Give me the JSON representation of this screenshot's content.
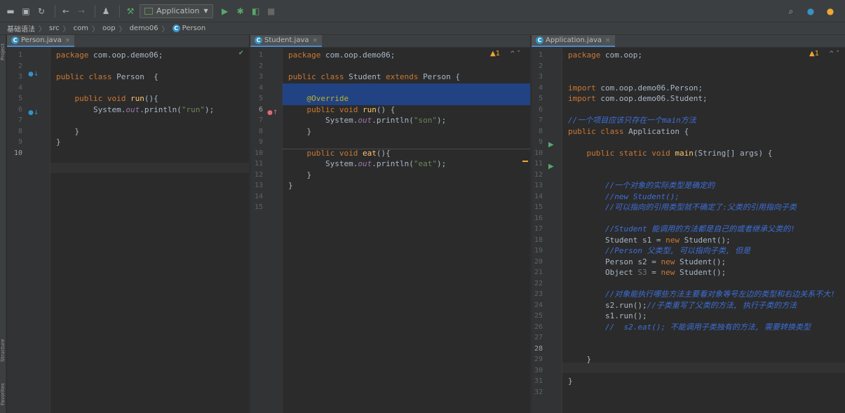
{
  "toolbar": {
    "run_config": "Application"
  },
  "breadcrumb": [
    "基础语法",
    "src",
    "com",
    "oop",
    "demo06",
    "Person"
  ],
  "sidebar": {
    "project": "Project",
    "structure": "Structure",
    "favorites": "Favorites"
  },
  "panes": [
    {
      "tab": "Person.java",
      "line_numbers": [
        "1",
        "2",
        "3",
        "4",
        "5",
        "6",
        "7",
        "8",
        "9",
        "10"
      ],
      "lines": [
        [
          {
            "t": "package ",
            "c": "kw"
          },
          {
            "t": "com.oop.demo06;",
            "c": "pl"
          }
        ],
        [],
        [
          {
            "t": "public class ",
            "c": "kw"
          },
          {
            "t": "Person  {",
            "c": "pl"
          }
        ],
        [],
        [
          {
            "t": "    public void ",
            "c": "kw"
          },
          {
            "t": "run",
            "c": "fn"
          },
          {
            "t": "(){",
            "c": "pl"
          }
        ],
        [
          {
            "t": "        System.",
            "c": "pl"
          },
          {
            "t": "out",
            "c": "it"
          },
          {
            "t": ".println(",
            "c": "pl"
          },
          {
            "t": "\"run\"",
            "c": "str"
          },
          {
            "t": ");",
            "c": "pl"
          }
        ],
        [],
        [
          {
            "t": "    }",
            "c": "pl"
          }
        ],
        [
          {
            "t": "}",
            "c": "pl"
          }
        ],
        []
      ]
    },
    {
      "tab": "Student.java",
      "warning": "▲1",
      "line_numbers": [
        "1",
        "2",
        "3",
        "4",
        "5",
        "6",
        "7",
        "8",
        "9",
        "10",
        "11",
        "12",
        "13",
        "14",
        "15"
      ],
      "lines": [
        [
          {
            "t": "package ",
            "c": "kw"
          },
          {
            "t": "com.oop.demo06;",
            "c": "pl"
          }
        ],
        [],
        [
          {
            "t": "public class ",
            "c": "kw"
          },
          {
            "t": "Student ",
            "c": "pl"
          },
          {
            "t": "extends ",
            "c": "kw"
          },
          {
            "t": "Person {",
            "c": "pl"
          }
        ],
        [],
        [
          {
            "t": "    @Override",
            "c": "ann"
          }
        ],
        [
          {
            "t": "    public void ",
            "c": "kw"
          },
          {
            "t": "run",
            "c": "fn"
          },
          {
            "t": "() {",
            "c": "pl"
          }
        ],
        [
          {
            "t": "        System.",
            "c": "pl"
          },
          {
            "t": "out",
            "c": "it"
          },
          {
            "t": ".println(",
            "c": "pl"
          },
          {
            "t": "\"son\"",
            "c": "str"
          },
          {
            "t": ");",
            "c": "pl"
          }
        ],
        [
          {
            "t": "    }",
            "c": "pl"
          }
        ],
        [],
        [
          {
            "t": "    public void ",
            "c": "kw"
          },
          {
            "t": "eat",
            "c": "fn"
          },
          {
            "t": "(){",
            "c": "pl"
          }
        ],
        [
          {
            "t": "        System.",
            "c": "pl"
          },
          {
            "t": "out",
            "c": "it"
          },
          {
            "t": ".println(",
            "c": "pl"
          },
          {
            "t": "\"eat\"",
            "c": "str"
          },
          {
            "t": ");",
            "c": "pl"
          }
        ],
        [
          {
            "t": "    }",
            "c": "pl"
          }
        ],
        [
          {
            "t": "}",
            "c": "pl"
          }
        ],
        [],
        []
      ]
    },
    {
      "tab": "Application.java",
      "warning": "▲1",
      "line_numbers": [
        "1",
        "2",
        "3",
        "4",
        "5",
        "6",
        "7",
        "8",
        "9",
        "10",
        "11",
        "12",
        "13",
        "14",
        "15",
        "16",
        "17",
        "18",
        "19",
        "20",
        "21",
        "22",
        "23",
        "24",
        "25",
        "26",
        "27",
        "28",
        "29",
        "30",
        "31",
        "32"
      ],
      "lines": [
        [
          {
            "t": "package ",
            "c": "kw"
          },
          {
            "t": "com.oop;",
            "c": "pl"
          }
        ],
        [],
        [],
        [
          {
            "t": "import ",
            "c": "kw"
          },
          {
            "t": "com.oop.demo06.Person;",
            "c": "pl"
          }
        ],
        [
          {
            "t": "import ",
            "c": "kw"
          },
          {
            "t": "com.oop.demo06.Student;",
            "c": "pl"
          }
        ],
        [],
        [
          {
            "t": "//一个项目应该只存在一个main方法",
            "c": "cmb"
          }
        ],
        [
          {
            "t": "public class ",
            "c": "kw"
          },
          {
            "t": "Application {",
            "c": "pl"
          }
        ],
        [],
        [
          {
            "t": "    public static void ",
            "c": "kw"
          },
          {
            "t": "main",
            "c": "fn"
          },
          {
            "t": "(String[] args) {",
            "c": "pl"
          }
        ],
        [],
        [],
        [
          {
            "t": "        //一个对象的实际类型是确定的",
            "c": "cmb"
          }
        ],
        [
          {
            "t": "        //new Student();",
            "c": "cmb"
          }
        ],
        [
          {
            "t": "        //可以指向的引用类型就不确定了:父类的引用指向子类",
            "c": "cmb"
          }
        ],
        [],
        [
          {
            "t": "        //Student 能调用的方法都是自己的或者继承父类的!",
            "c": "cmb"
          }
        ],
        [
          {
            "t": "        Student s1 = ",
            "c": "pl"
          },
          {
            "t": "new ",
            "c": "kw"
          },
          {
            "t": "Student();",
            "c": "pl"
          }
        ],
        [
          {
            "t": "        //Person 父类型, 可以指向子类, 但是",
            "c": "cmb"
          }
        ],
        [
          {
            "t": "        Person s2 = ",
            "c": "pl"
          },
          {
            "t": "new ",
            "c": "kw"
          },
          {
            "t": "Student();",
            "c": "pl"
          }
        ],
        [
          {
            "t": "        Object ",
            "c": "pl"
          },
          {
            "t": "S3",
            "c": "dim"
          },
          {
            "t": " = ",
            "c": "pl"
          },
          {
            "t": "new ",
            "c": "kw"
          },
          {
            "t": "Student();",
            "c": "pl"
          }
        ],
        [],
        [
          {
            "t": "        //对象能执行哪些方法主要看对象等号左边的类型和右边关系不大!",
            "c": "cmb"
          }
        ],
        [
          {
            "t": "        s2.run();",
            "c": "pl"
          },
          {
            "t": "//子类重写了父类的方法, 执行子类的方法",
            "c": "cmb"
          }
        ],
        [
          {
            "t": "        s1.run();",
            "c": "pl"
          }
        ],
        [
          {
            "t": "        //  s2.eat(); 不能调用子类独有的方法, 需要转换类型",
            "c": "cmb"
          }
        ],
        [],
        [],
        [
          {
            "t": "    }",
            "c": "pl"
          }
        ],
        [],
        [
          {
            "t": "}",
            "c": "pl"
          }
        ],
        []
      ]
    }
  ]
}
